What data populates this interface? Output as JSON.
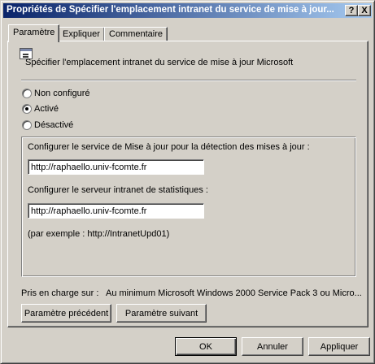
{
  "window": {
    "title": "Propriétés de Spécifier l'emplacement intranet du service de mise à jour...",
    "help_label": "?",
    "close_label": "X"
  },
  "tabs": [
    {
      "label": "Paramètre",
      "active": true
    },
    {
      "label": "Expliquer",
      "active": false
    },
    {
      "label": "Commentaire",
      "active": false
    }
  ],
  "policy": {
    "icon": "policy-setting-icon",
    "title": "Spécifier l'emplacement intranet du service de mise à jour Microsoft"
  },
  "options": [
    {
      "label": "Non configuré",
      "selected": false
    },
    {
      "label": "Activé",
      "selected": true
    },
    {
      "label": "Désactivé",
      "selected": false
    }
  ],
  "settings": {
    "update_service_label": "Configurer le service de Mise à jour pour la détection des mises à jour :",
    "update_service_value": "http://raphaello.univ-fcomte.fr",
    "stats_server_label": "Configurer le serveur intranet de statistiques :",
    "stats_server_value": "http://raphaello.univ-fcomte.fr",
    "example": "(par exemple : http://IntranetUpd01)"
  },
  "support": {
    "label": "Pris en charge sur :",
    "value": "Au minimum Microsoft Windows 2000 Service Pack 3 ou Micro..."
  },
  "nav": {
    "previous_label": "Paramètre précédent",
    "next_label": "Paramètre suivant"
  },
  "dialog_buttons": {
    "ok_label": "OK",
    "cancel_label": "Annuler",
    "apply_label": "Appliquer"
  },
  "colors": {
    "title_start": "#0a246a",
    "title_end": "#a6caf0",
    "face": "#d4d0c8"
  }
}
